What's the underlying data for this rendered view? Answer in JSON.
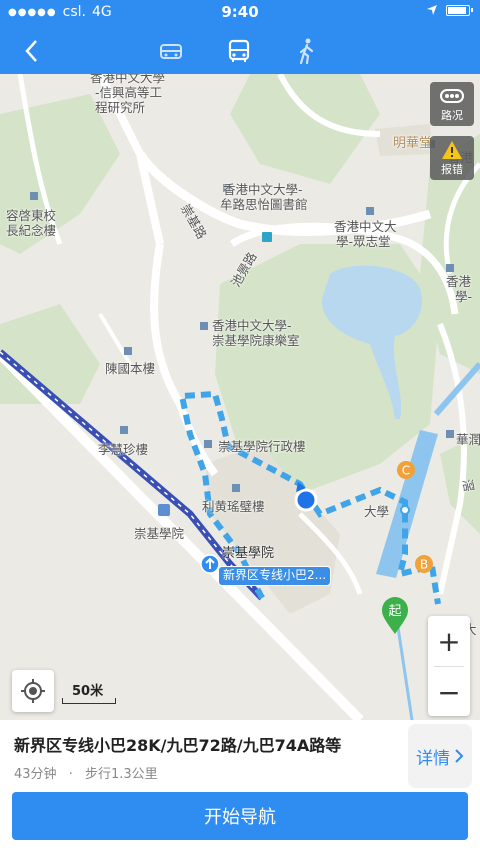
{
  "status_bar": {
    "carrier": "csl.",
    "network": "4G",
    "time": "9:40"
  },
  "nav": {
    "back_icon": "back-chevron-icon",
    "modes": [
      "car-icon",
      "bus-icon",
      "walk-icon"
    ],
    "active_mode": "bus-icon"
  },
  "map": {
    "labels": [
      "香港中文大學",
      "-信興高等工",
      "程研究所",
      "明華堂",
      "香港",
      "容啓東校",
      "長紀念樓",
      "香港中文大學-",
      "牟路思怡圖書館",
      "崇基路",
      "香港中文大",
      "學-眾志堂",
      "池景路",
      "香港",
      "學-",
      "香港中文大學-",
      "崇基學院康樂室",
      "陳國本樓",
      "崇基學院行政樓",
      "李慧珍樓",
      "華潤",
      "利黄瑤璧樓",
      "大學",
      "崇基學院",
      "崇基學院",
      "滘",
      "大"
    ],
    "bus_tag": "新界区专线小巴2...",
    "badges": {
      "c": "C",
      "b": "B",
      "start": "起"
    },
    "traffic_button": "路况",
    "report_button": "报错",
    "zoom_in": "+",
    "zoom_out": "−",
    "scale": "50米"
  },
  "route": {
    "title": "新界区专线小巴28K/九巴72路/九巴74A路等",
    "duration": "43分钟",
    "separator": "·",
    "walk": "步行1.3公里",
    "details_label": "详情",
    "start_label": "开始导航"
  }
}
